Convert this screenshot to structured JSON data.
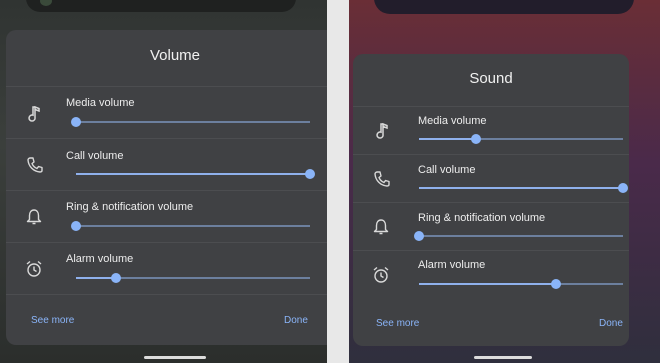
{
  "left_panel": {
    "title": "Volume",
    "rows": [
      {
        "label": "Media volume",
        "icon": "music-note-icon",
        "level": 0.0
      },
      {
        "label": "Call volume",
        "icon": "phone-icon",
        "level": 1.0
      },
      {
        "label": "Ring & notification volume",
        "icon": "bell-icon",
        "level": 0.0
      },
      {
        "label": "Alarm volume",
        "icon": "alarm-clock-icon",
        "level": 0.17
      }
    ],
    "see_more": "See more",
    "done": "Done"
  },
  "right_panel": {
    "title": "Sound",
    "rows": [
      {
        "label": "Media volume",
        "icon": "music-note-icon",
        "level": 0.28
      },
      {
        "label": "Call volume",
        "icon": "phone-icon",
        "level": 1.0
      },
      {
        "label": "Ring & notification volume",
        "icon": "bell-icon",
        "level": 0.0
      },
      {
        "label": "Alarm volume",
        "icon": "alarm-clock-icon",
        "level": 0.67
      }
    ],
    "see_more": "See more",
    "done": "Done"
  },
  "colors": {
    "accent": "#8ab4f8",
    "panel_bg": "#404144",
    "track": "#6c7f9e"
  }
}
